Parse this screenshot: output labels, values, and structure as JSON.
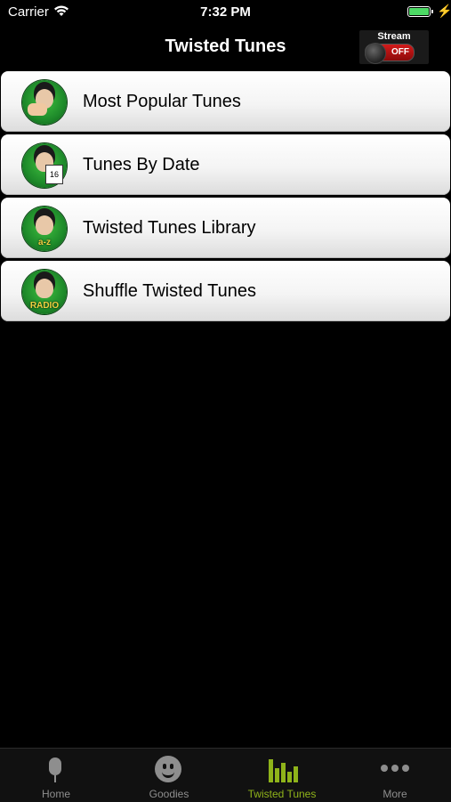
{
  "status_bar": {
    "carrier": "Carrier",
    "time": "7:32 PM"
  },
  "nav": {
    "title": "Twisted Tunes",
    "stream_toggle": {
      "label": "Stream",
      "state": "OFF"
    }
  },
  "menu": {
    "items": [
      {
        "label": "Most Popular Tunes",
        "icon": "thumbs-up-logo-icon"
      },
      {
        "label": "Tunes By Date",
        "icon": "calendar-logo-icon",
        "badge": "16"
      },
      {
        "label": "Twisted Tunes Library",
        "icon": "a-z-logo-icon",
        "badge": "a-z"
      },
      {
        "label": "Shuffle Twisted Tunes",
        "icon": "radio-logo-icon",
        "badge": "RADIO"
      }
    ]
  },
  "tab_bar": {
    "tabs": [
      {
        "label": "Home",
        "icon": "microphone-icon"
      },
      {
        "label": "Goodies",
        "icon": "smiley-icon"
      },
      {
        "label": "Twisted Tunes",
        "icon": "equalizer-icon",
        "active": true
      },
      {
        "label": "More",
        "icon": "more-dots-icon"
      }
    ],
    "active_color": "#8fb31a",
    "inactive_color": "#8e8e8e"
  }
}
